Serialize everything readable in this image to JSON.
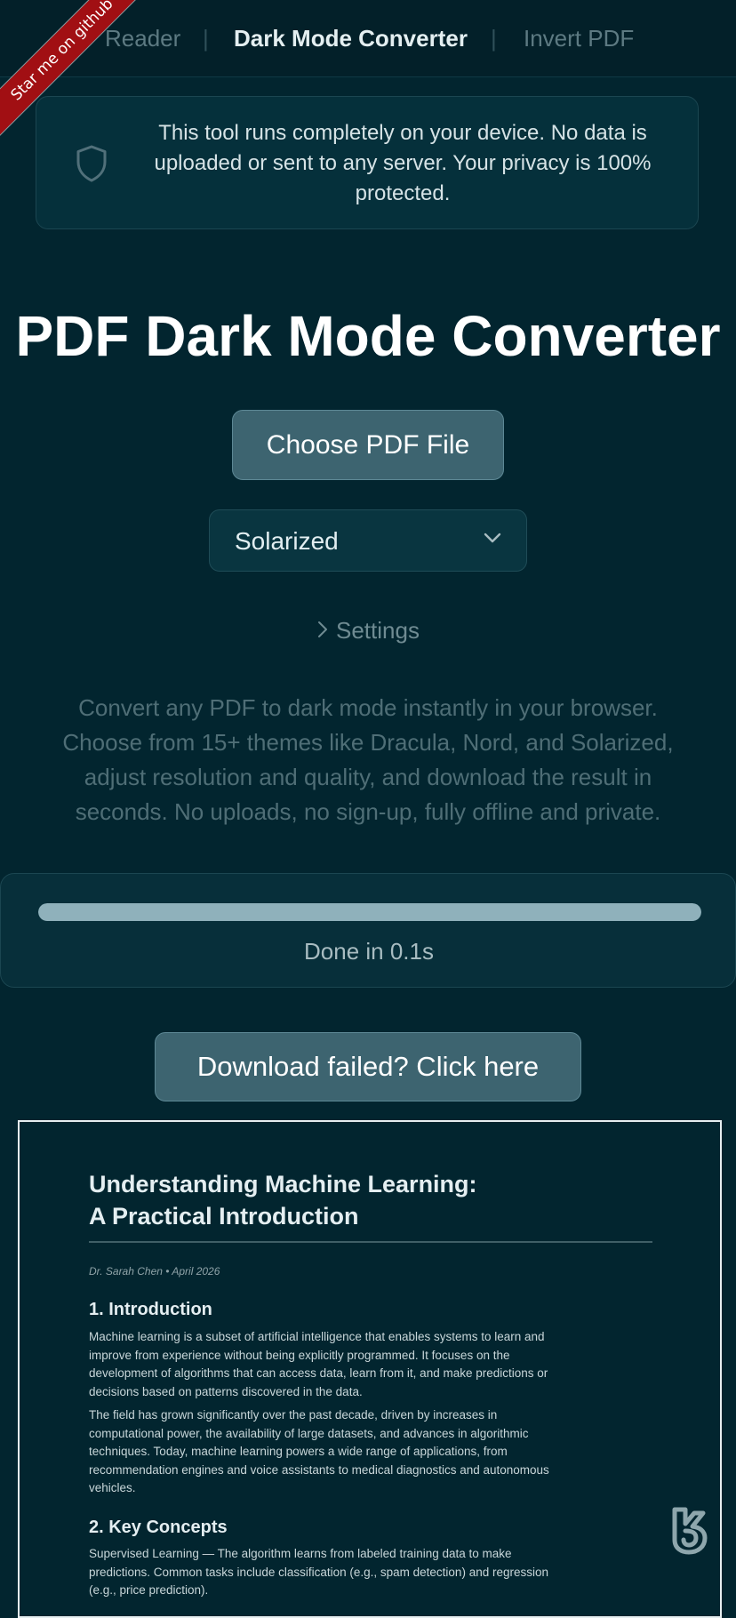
{
  "nav": {
    "items": [
      {
        "label": "Reader",
        "active": false
      },
      {
        "label": "Dark Mode Converter",
        "active": true
      },
      {
        "label": "Invert PDF",
        "active": false
      }
    ],
    "separator": "|"
  },
  "ribbon": {
    "label": "Star me on github"
  },
  "privacy": {
    "text": "This tool runs completely on your device. No data is uploaded or sent to any server. Your privacy is 100% protected.",
    "icon": "shield-icon"
  },
  "main": {
    "title": "PDF Dark Mode Converter",
    "choose_button": "Choose PDF File",
    "theme_select": {
      "value": "Solarized"
    },
    "settings_label": "Settings",
    "description": "Convert any PDF to dark mode instantly in your browser. Choose from 15+ themes like Dracula, Nord, and Solarized, adjust resolution and quality, and download the result in seconds. No uploads, no sign-up, fully offline and private."
  },
  "progress": {
    "percent": 100,
    "label": "Done in 0.1s"
  },
  "download_button": "Download failed? Click here",
  "preview": {
    "title_line1": "Understanding Machine Learning:",
    "title_line2": "A Practical Introduction",
    "meta": "Dr. Sarah Chen  •  April 2026",
    "section1_heading": "1. Introduction",
    "section1_p1": "Machine learning is a subset of artificial intelligence that enables systems to learn and improve from experience without being explicitly programmed. It focuses on the development of algorithms that can access data, learn from it, and make predictions or decisions based on patterns discovered in the data.",
    "section1_p2": "The field has grown significantly over the past decade, driven by increases in computational power, the availability of large datasets, and advances in algorithmic techniques. Today, machine learning powers a wide range of applications, from recommendation engines and voice assistants to medical diagnostics and autonomous vehicles.",
    "section2_heading": "2. Key Concepts",
    "section2_p1": "Supervised Learning — The algorithm learns from labeled training data to make predictions. Common tasks include classification (e.g., spam detection) and regression (e.g., price prediction)."
  },
  "colors": {
    "background": "#02252f",
    "button": "#3d6470",
    "progress_fill": "#8fb1bb",
    "ribbon": "#a10f13"
  }
}
